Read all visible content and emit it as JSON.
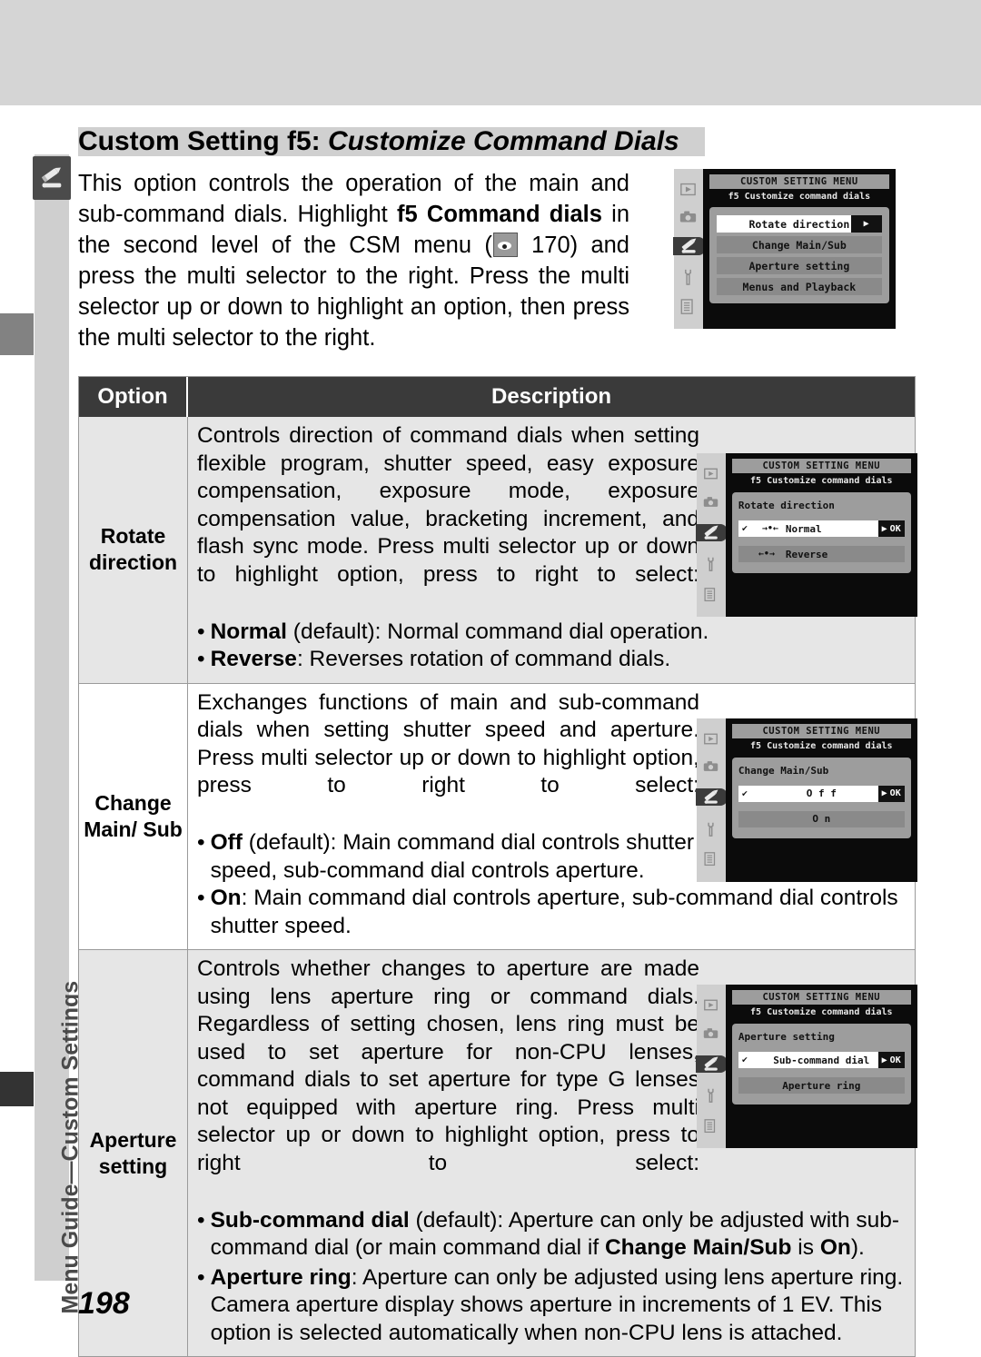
{
  "page": {
    "number": "198",
    "sidebar_label": "Menu Guide—Custom Settings",
    "sidebar_icon": "pencil-icon"
  },
  "title": {
    "prefix": "Custom Setting f5: ",
    "italic": "Customize Command Dials"
  },
  "intro": {
    "part1": "This option controls the operation of the main and sub-command dials.  Highlight ",
    "bold1": "f5 Command dials",
    "part2": " in the second level of the CSM menu (",
    "icon": "csm-eye-icon",
    "part3": " 170) and press the multi selector to the right.  Press the multi selector up or down to highlight an option, then press the multi selector to the right."
  },
  "lcd_intro": {
    "title": "CUSTOM SETTING MENU",
    "subtitle": "f5  Customize command dials",
    "rail_icons": [
      "playback-icon",
      "camera-icon",
      "pencil-icon",
      "wrench-icon",
      "list-icon"
    ],
    "selected_rail_index": 2,
    "items": [
      {
        "label": "Rotate direction",
        "selected": true,
        "arrow": "▶"
      },
      {
        "label": "Change Main/Sub",
        "selected": false
      },
      {
        "label": "Aperture setting",
        "selected": false
      },
      {
        "label": "Menus and Playback",
        "selected": false
      }
    ]
  },
  "table": {
    "headers": {
      "option": "Option",
      "description": "Description"
    },
    "rows": [
      {
        "option": "Rotate direction",
        "body": "Controls direction of command dials when setting flexible program, shutter speed, easy exposure compensation, exposure mode, exposure compensation value, bracketing increment, and flash sync mode.  Press multi selector up or down to highlight option, press to right to select:",
        "bullets": [
          {
            "bold": "Normal",
            "rest": " (default): Normal command dial operation."
          },
          {
            "bold": "Reverse",
            "rest": ": Reverses rotation of command dials."
          }
        ],
        "lcd": {
          "title": "CUSTOM SETTING MENU",
          "subtitle": "f5  Customize command dials",
          "heading": "Rotate direction",
          "rail_icons": [
            "playback-icon",
            "camera-icon",
            "pencil-icon",
            "wrench-icon",
            "list-icon"
          ],
          "selected_rail_index": 2,
          "items": [
            {
              "label": "Normal",
              "selected": true,
              "check": "✔",
              "arrows": "→•←",
              "ok": "OK"
            },
            {
              "label": "Reverse",
              "selected": false,
              "arrows": "←•→"
            }
          ]
        }
      },
      {
        "option": "Change Main/ Sub",
        "body": "Exchanges functions of main and sub-command dials when setting shutter speed and aperture.  Press multi selector up or down to highlight option, press to right to select:",
        "bullets": [
          {
            "bold": "Off",
            "rest": " (default): Main command dial controls shutter speed, sub-command dial controls aperture."
          },
          {
            "bold": "On",
            "rest": ": Main command dial controls aperture, sub-command dial controls shutter speed."
          }
        ],
        "lcd": {
          "title": "CUSTOM SETTING MENU",
          "subtitle": "f5  Customize command dials",
          "heading": "Change Main/Sub",
          "rail_icons": [
            "playback-icon",
            "camera-icon",
            "pencil-icon",
            "wrench-icon",
            "list-icon"
          ],
          "selected_rail_index": 2,
          "items": [
            {
              "label": "O f f",
              "selected": true,
              "check": "✔",
              "ok": "OK"
            },
            {
              "label": "O n",
              "selected": false
            }
          ]
        }
      },
      {
        "option": "Aperture setting",
        "body": "Controls whether changes to aperture are made using lens aperture ring or command dials.  Regardless of setting chosen, lens ring must be used to set aperture for non-CPU lenses, command dials to set aperture for type G lenses not equipped with aperture ring.  Press multi selector up or down to highlight option, press to right to select:",
        "bullets": [
          {
            "bold": "Sub-command dial",
            "rest": " (default): Aperture can only be adjusted with sub-command dial (or main command dial if ",
            "bold2": "Change Main/Sub",
            "rest2": " is ",
            "bold3": "On",
            "rest3": ")."
          },
          {
            "bold": "Aperture ring",
            "rest": ": Aperture can only be adjusted using lens aperture ring.  Camera aperture display shows aperture in increments of 1 EV.  This option is selected automatically when non-CPU lens is attached."
          }
        ],
        "lcd": {
          "title": "CUSTOM SETTING MENU",
          "subtitle": "f5  Customize command dials",
          "heading": "Aperture setting",
          "rail_icons": [
            "playback-icon",
            "camera-icon",
            "pencil-icon",
            "wrench-icon",
            "list-icon"
          ],
          "selected_rail_index": 2,
          "items": [
            {
              "label": "Sub-command dial",
              "selected": true,
              "check": "✔",
              "ok": "OK"
            },
            {
              "label": "Aperture ring",
              "selected": false
            }
          ]
        }
      }
    ]
  },
  "colors": {
    "page_band": "#d5d5d5",
    "sidebar": "#cfcfcf",
    "table_header": "#3a3a3a",
    "row_alt": "#e6e6e6",
    "lcd_screen": "#0b0b0b",
    "lcd_panel": "#9d9d9d"
  }
}
